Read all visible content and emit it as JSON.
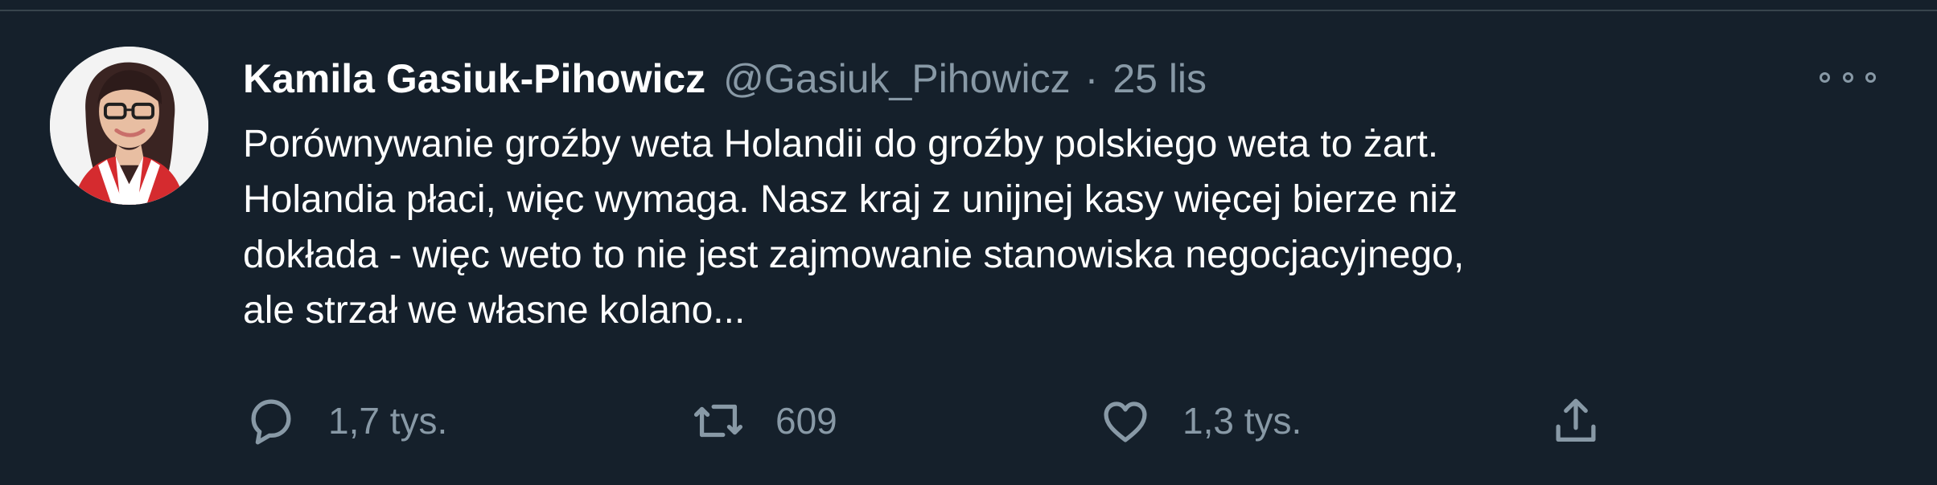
{
  "author": {
    "name": "Kamila Gasiuk-Pihowicz",
    "handle": "@Gasiuk_Pihowicz",
    "separator": "·",
    "time": "25 lis"
  },
  "tweet": {
    "text": "Porównywanie groźby weta Holandii do groźby polskiego weta to żart.\nHolandia płaci, więc wymaga. Nasz kraj z unijnej kasy więcej bierze niż\ndokłada - więc weto to nie jest zajmowanie stanowiska negocjacyjnego,\nale strzał we własne kolano..."
  },
  "actions": {
    "reply_count": "1,7 tys.",
    "retweet_count": "609",
    "like_count": "1,3 tys."
  },
  "icons": {
    "more": "more-horizontal-icon",
    "reply": "reply-icon",
    "retweet": "retweet-icon",
    "like": "heart-icon",
    "share": "share-icon"
  },
  "colors": {
    "background": "#15202b",
    "primary_text": "#ffffff",
    "secondary_text": "#8899a6",
    "border": "#38444d"
  }
}
